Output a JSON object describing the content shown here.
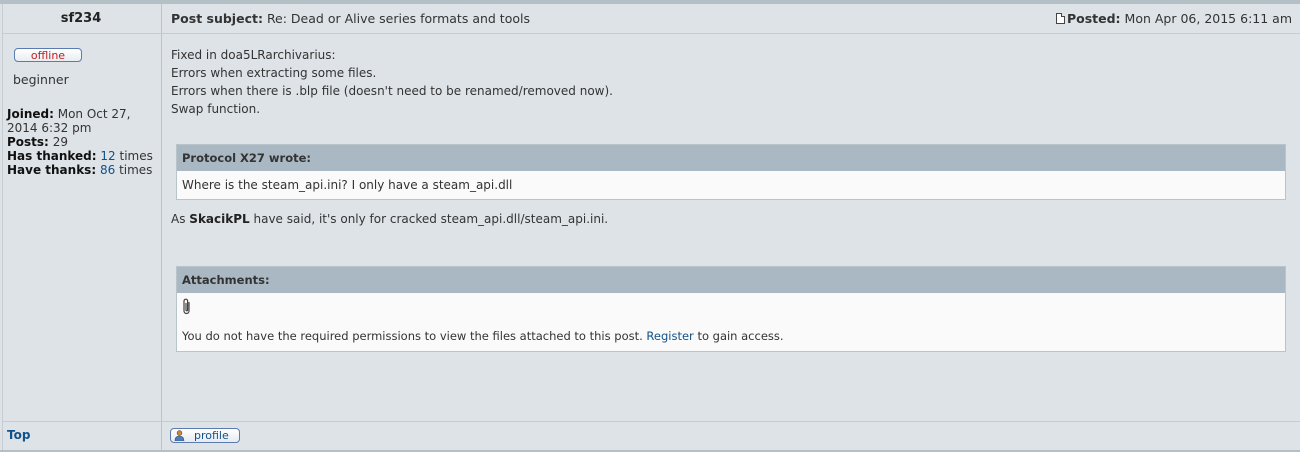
{
  "author": {
    "name": "sf234",
    "status": "offline",
    "rank": "beginner",
    "joined_label": "Joined:",
    "joined_value": "Mon Oct 27, 2014 6:32 pm",
    "posts_label": "Posts:",
    "posts_value": "29",
    "has_thanked_label": "Has thanked:",
    "has_thanked_count": "12",
    "has_thanked_suffix": "times",
    "have_thanks_label": "Have thanks:",
    "have_thanks_count": "86",
    "have_thanks_suffix": "times"
  },
  "post": {
    "subject_label": "Post subject:",
    "subject": "Re: Dead or Alive series formats and tools",
    "posted_label": "Posted:",
    "posted": "Mon Apr 06, 2015 6:11 am",
    "body_lines": [
      "Fixed in doa5LRarchivarius:",
      "Errors when extracting some files.",
      "Errors when there is .blp file (doesn't need to be renamed/removed now).",
      "Swap function."
    ],
    "quote_author": "Protocol X27 wrote:",
    "quote_text": "Where is the steam_api.ini? I only have a steam_api.dll",
    "after_prefix": "As",
    "after_name": "SkacikPL",
    "after_text": "have said, it's only for cracked steam_api.dll/steam_api.ini."
  },
  "attachments": {
    "header": "Attachments:",
    "message_prefix": "You do not have the required permissions to view the files attached to this post.",
    "register_link": "Register",
    "message_suffix": "to gain access."
  },
  "footer": {
    "top_link": "Top",
    "profile_button": "profile"
  },
  "icons": {
    "posted": "document-icon",
    "attachment": "paperclip-icon",
    "profile": "person-icon"
  },
  "colors": {
    "background": "#dee3e7",
    "link": "#105289",
    "offline": "#c02020",
    "box_header": "#a9b8c2"
  }
}
